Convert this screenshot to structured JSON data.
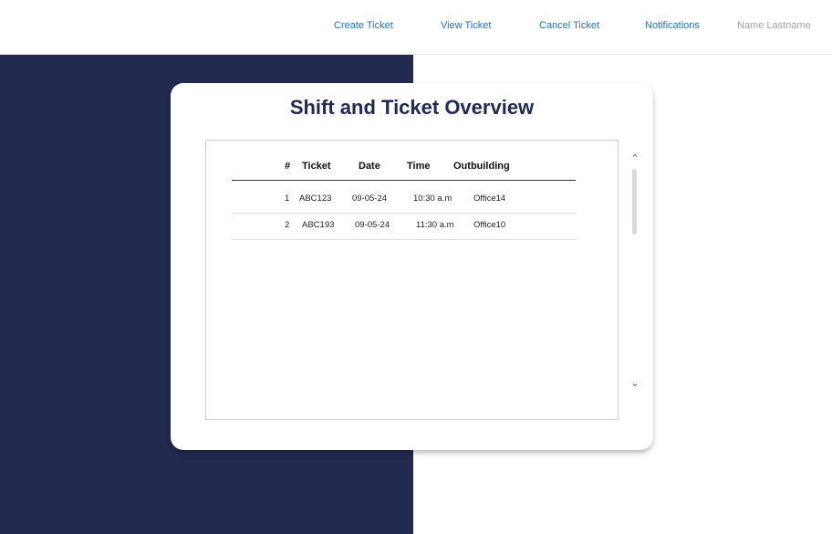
{
  "nav": {
    "create_ticket": "Create Ticket",
    "view_ticket": "View Ticket",
    "cancel_ticket": "Cancel Ticket",
    "notifications": "Notifications",
    "user_name": "Name Lastname"
  },
  "card": {
    "title": "Shift and Ticket Overview"
  },
  "table": {
    "columns": [
      "#",
      "Ticket",
      "Date",
      "Time",
      "Outbuilding"
    ],
    "rows": [
      {
        "num": "1",
        "ticket": "ABC123",
        "date": "09-05-24",
        "time": "10:30 a.m",
        "outbuilding": "Office14"
      },
      {
        "num": "2",
        "ticket": "ABC193",
        "date": "09-05-24",
        "time": "11:30 a.m",
        "outbuilding": "Office10"
      }
    ]
  },
  "icons": {
    "scroll_up": "chevron-up-icon",
    "scroll_down": "chevron-down-icon"
  },
  "colors": {
    "navy": "#222a4f",
    "link": "#1f73b7",
    "muted": "#a3a3a3"
  }
}
